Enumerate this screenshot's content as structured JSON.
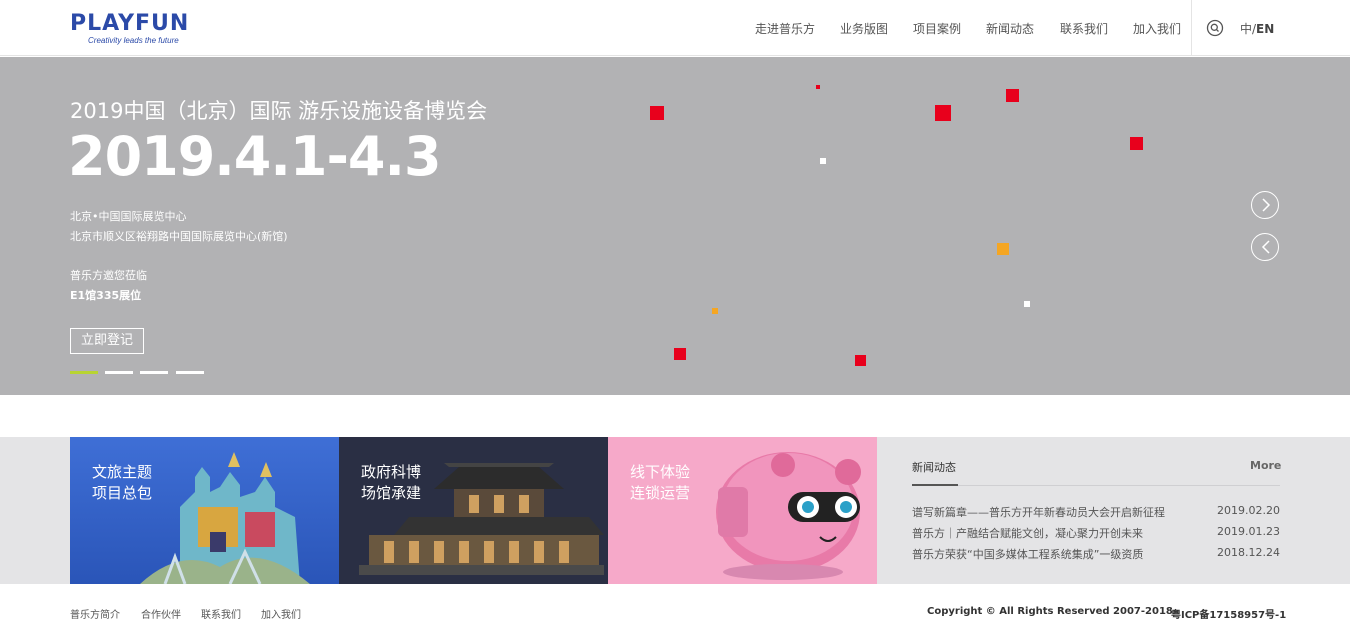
{
  "header": {
    "logo_text": "PLAYFUN",
    "logo_tagline": "Creativity leads the future",
    "nav": [
      {
        "label": "走进普乐方"
      },
      {
        "label": "业务版图"
      },
      {
        "label": "项目案例"
      },
      {
        "label": "新闻动态"
      },
      {
        "label": "联系我们"
      },
      {
        "label": "加入我们"
      }
    ],
    "lang_zh": "中/",
    "lang_en": "EN",
    "search_icon": "search-icon"
  },
  "banner": {
    "title": "2019中国（北京）国际 游乐设施设备博览会",
    "date": "2019.4.1-4.3",
    "venue_1": "北京•中国国际展览中心",
    "venue_2": "北京市顺义区裕翔路中国国际展览中心(新馆)",
    "invite": "普乐方邀您莅临",
    "booth": "E1馆335展位",
    "register_label": "立即登记",
    "slide_count": 4,
    "active_slide": 1,
    "colors": {
      "background": "#b2b2b4",
      "accent_red": "#e8001c",
      "accent_orange": "#f5a623",
      "active_dot": "#b8d432"
    },
    "icons": {
      "next": "chevron-right-icon",
      "prev": "chevron-left-icon"
    }
  },
  "tiles": [
    {
      "line1": "文旅主题",
      "line2": "项目总包",
      "color": "#2f5fc8"
    },
    {
      "line1": "政府科博",
      "line2": "场馆承建",
      "color": "#2a2f44"
    },
    {
      "line1": "线下体验",
      "line2": "连锁运营",
      "color": "#f6a9c9"
    }
  ],
  "news": {
    "tab": "新闻动态",
    "more": "More",
    "items": [
      {
        "title": "谱写新篇章——普乐方开年新春动员大会开启新征程",
        "date": "2019.02.20"
      },
      {
        "title": "普乐方｜产融结合赋能文创，凝心聚力开创未来",
        "date": "2019.01.23"
      },
      {
        "title": "普乐方荣获“中国多媒体工程系统集成”一级资质",
        "date": "2018.12.24"
      }
    ]
  },
  "footer": {
    "links": [
      {
        "label": "普乐方简介"
      },
      {
        "label": "合作伙伴"
      },
      {
        "label": "联系我们"
      },
      {
        "label": "加入我们"
      }
    ],
    "copyright": "Copyright © All Rights Reserved 2007-2018",
    "icp": "粤ICP备17158957号-1"
  }
}
